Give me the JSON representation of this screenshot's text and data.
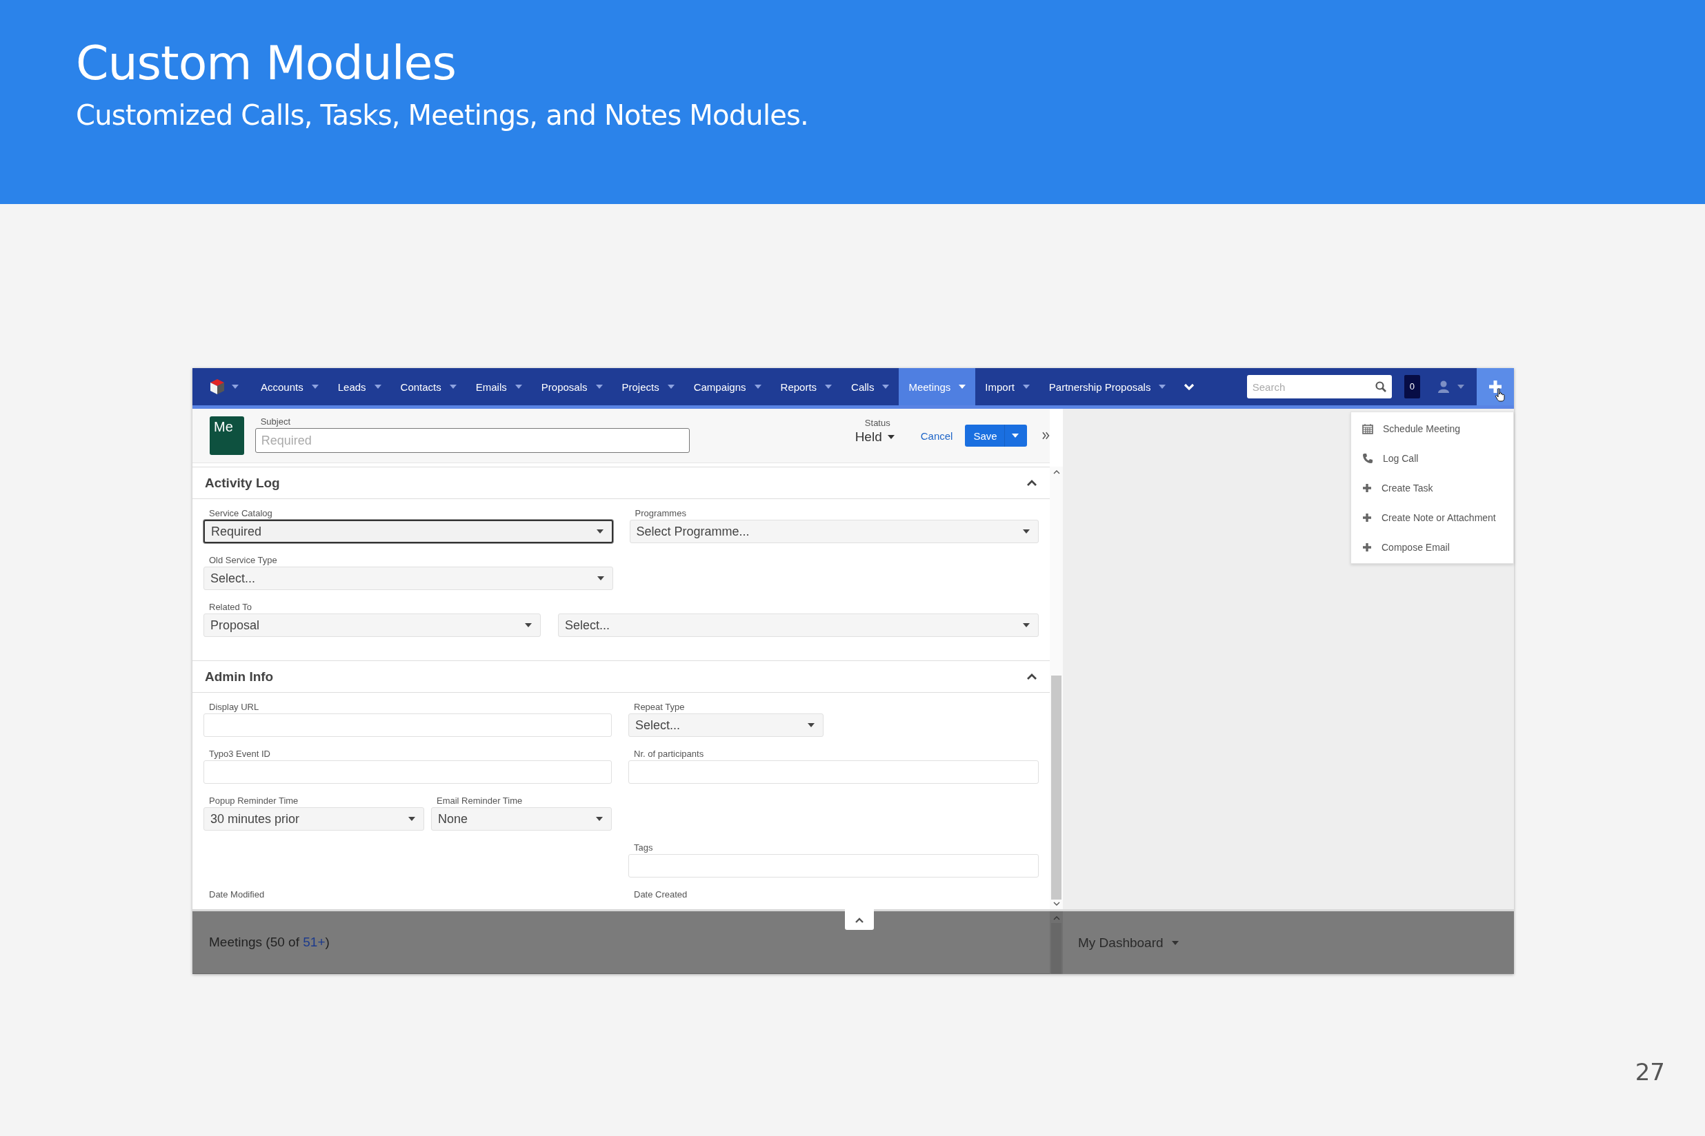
{
  "slide": {
    "title": "Custom Modules",
    "subtitle": "Customized Calls, Tasks, Meetings, and Notes Modules.",
    "page_number": "27"
  },
  "nav": {
    "items": [
      {
        "label": "Accounts",
        "selected": false
      },
      {
        "label": "Leads",
        "selected": false
      },
      {
        "label": "Contacts",
        "selected": false
      },
      {
        "label": "Emails",
        "selected": false
      },
      {
        "label": "Proposals",
        "selected": false
      },
      {
        "label": "Projects",
        "selected": false
      },
      {
        "label": "Campaigns",
        "selected": false
      },
      {
        "label": "Reports",
        "selected": false
      },
      {
        "label": "Calls",
        "selected": false
      },
      {
        "label": "Meetings",
        "selected": true
      },
      {
        "label": "Import",
        "selected": false
      },
      {
        "label": "Partnership Proposals",
        "selected": false
      }
    ],
    "search": {
      "placeholder": "Search"
    },
    "notifications": "0"
  },
  "quick_create_menu": [
    {
      "label": "Schedule Meeting",
      "kind": "calendar"
    },
    {
      "label": "Log Call",
      "kind": "phone"
    },
    {
      "label": "Create Task",
      "kind": "plus"
    },
    {
      "label": "Create Note or Attachment",
      "kind": "plus"
    },
    {
      "label": "Compose Email",
      "kind": "plus"
    }
  ],
  "record": {
    "avatar": "Me",
    "subject": {
      "label": "Subject",
      "placeholder": "Required"
    },
    "status": {
      "label": "Status",
      "value": "Held"
    },
    "cancel": "Cancel",
    "save": "Save"
  },
  "sections": [
    {
      "title": "Activity Log",
      "expanded": true,
      "rows": [
        [
          {
            "label": "Service Catalog",
            "kind": "select",
            "value": "Required",
            "focused": true
          },
          {
            "label": "Programmes",
            "kind": "select",
            "value": "Select Programme...",
            "focused": false
          }
        ],
        [
          {
            "label": "Old Service Type",
            "kind": "select",
            "value": "Select...",
            "focused": false
          }
        ],
        [
          {
            "label": "Related To",
            "kind": "select",
            "value": "Proposal",
            "focused": false
          },
          {
            "kind": "select",
            "value": "Select...",
            "focused": false
          }
        ]
      ]
    },
    {
      "title": "Admin Info",
      "expanded": true,
      "rows": [
        [
          {
            "label": "Display URL",
            "kind": "input",
            "focused": false
          },
          {
            "label": "Repeat Type",
            "kind": "select",
            "value": "Select...",
            "focused": false
          }
        ],
        [
          {
            "label": "Typo3 Event ID",
            "kind": "input",
            "focused": false
          },
          {
            "label": "Nr. of participants",
            "kind": "input",
            "focused": false
          }
        ],
        [
          {
            "label": "Popup Reminder Time",
            "kind": "select",
            "value": "30 minutes prior",
            "focused": false
          },
          {
            "label": "Email Reminder Time",
            "kind": "select",
            "value": "None",
            "focused": false
          }
        ],
        [
          "",
          {
            "label": "Tags",
            "kind": "input",
            "focused": false
          }
        ],
        [
          {
            "label": "Date Modified",
            "kind": "label"
          },
          {
            "label": "Date Created",
            "kind": "label"
          }
        ]
      ]
    }
  ],
  "dashlets": {
    "list": {
      "prefix": "Meetings (50 of ",
      "link": "51+",
      "suffix": ")"
    },
    "dashboard": "My Dashboard"
  }
}
